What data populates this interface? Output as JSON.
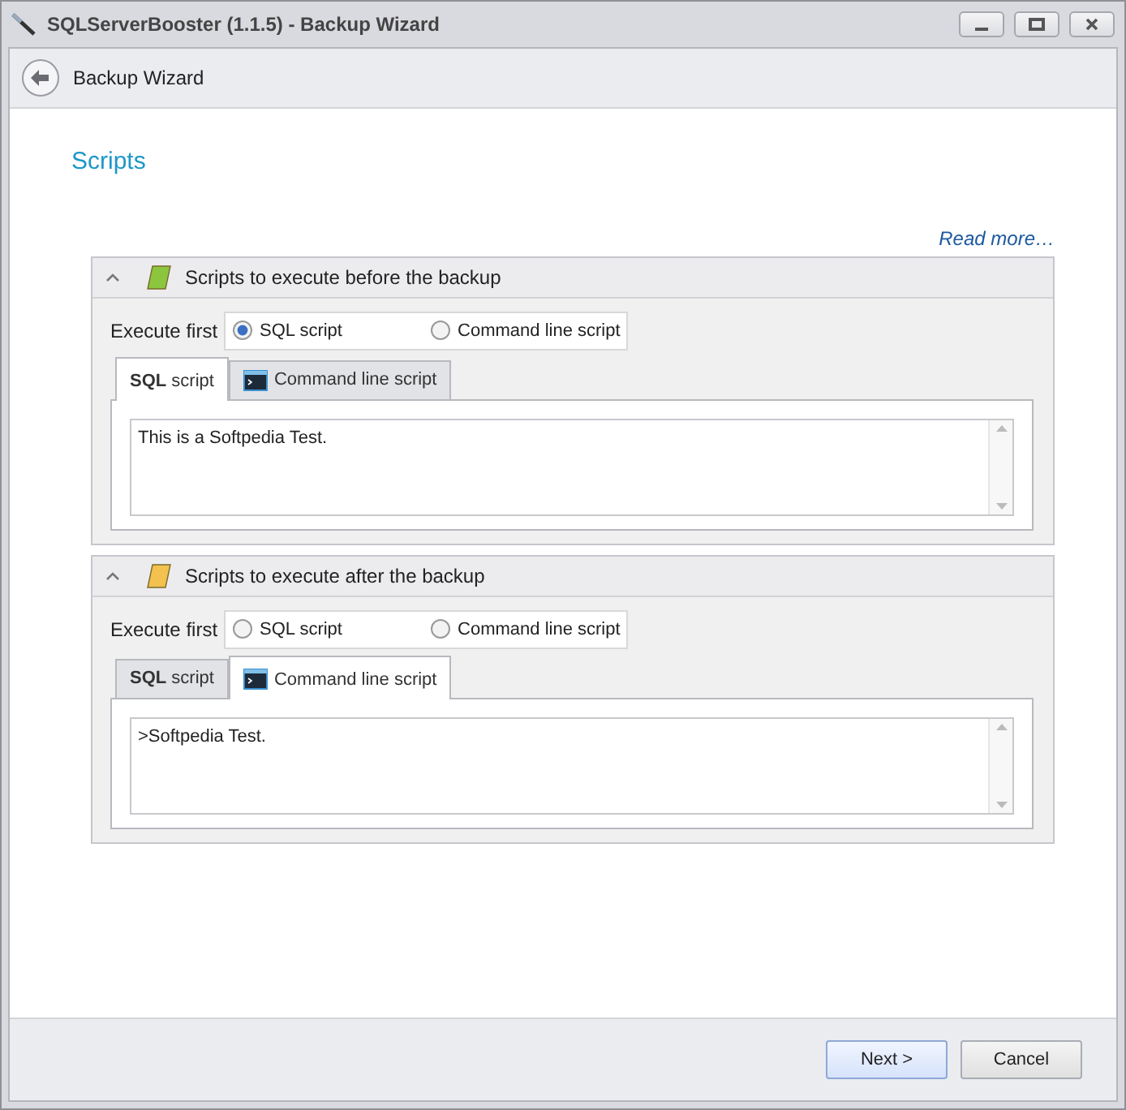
{
  "window": {
    "title": "SQLServerBooster (1.1.5) - Backup Wizard"
  },
  "header": {
    "title": "Backup Wizard"
  },
  "page_title": "Scripts",
  "read_more": "Read more…",
  "groups": [
    {
      "title": "Scripts to execute before the backup",
      "expanded": true,
      "color": "#8cc63f",
      "execute_label": "Execute first",
      "options": [
        {
          "label": "SQL script",
          "selected": true
        },
        {
          "label": "Command line script",
          "selected": false
        }
      ],
      "tabs": [
        {
          "label": "**SQL** script",
          "kind": "sql",
          "selected": true
        },
        {
          "label": "Command line script",
          "kind": "cmd",
          "selected": false
        }
      ],
      "text": "This is a Softpedia Test."
    },
    {
      "title": "Scripts to execute after the backup",
      "expanded": true,
      "color": "#f2c14e",
      "execute_label": "Execute first",
      "options": [
        {
          "label": "SQL script",
          "selected": false
        },
        {
          "label": "Command line script",
          "selected": false
        }
      ],
      "tabs": [
        {
          "label": "**SQL** script",
          "kind": "sql",
          "selected": false
        },
        {
          "label": "Command line script",
          "kind": "cmd",
          "selected": true
        }
      ],
      "text": ">Softpedia Test."
    }
  ],
  "buttons": [
    {
      "label": "Next >",
      "kind": "primary"
    },
    {
      "label": "Cancel",
      "kind": "secondary"
    }
  ]
}
